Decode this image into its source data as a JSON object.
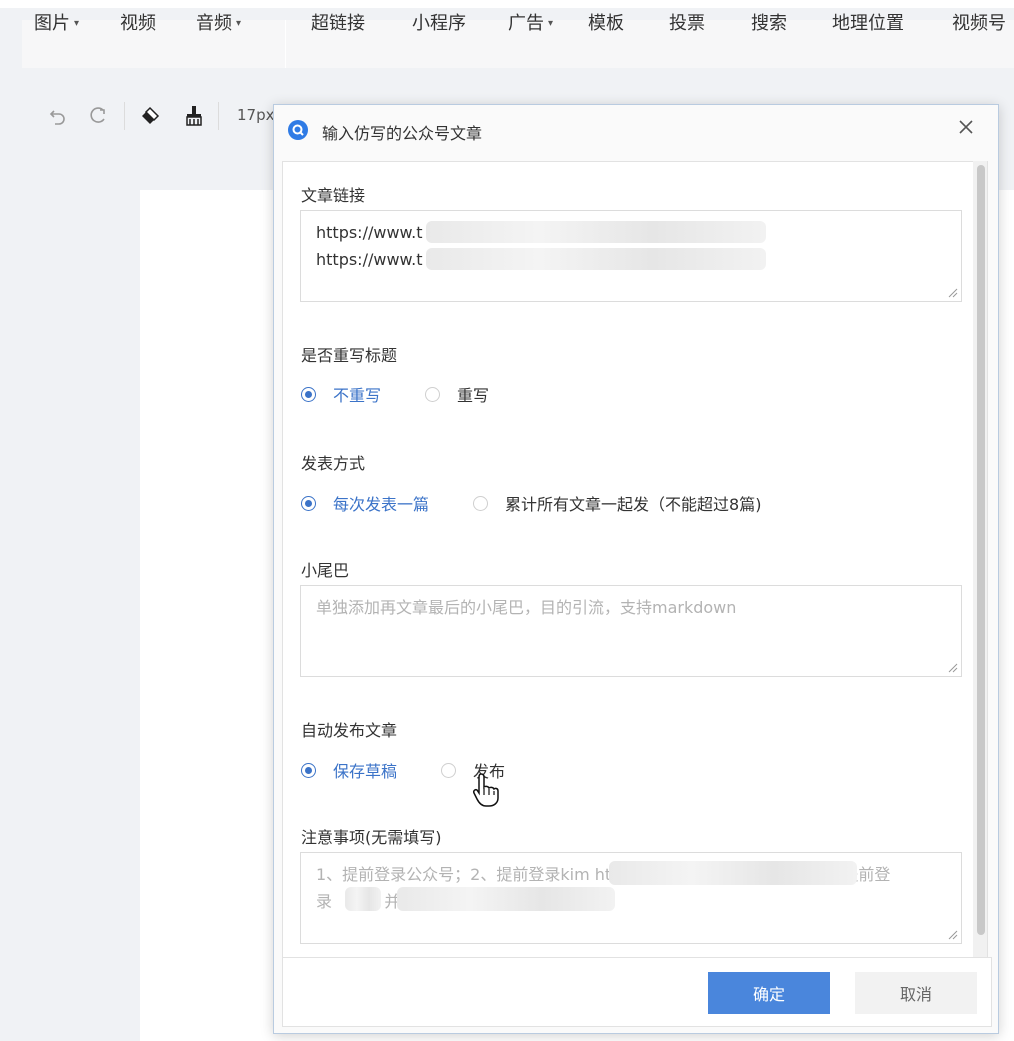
{
  "menubar": {
    "items": [
      {
        "label": "图片",
        "caret": true
      },
      {
        "label": "视频",
        "caret": false
      },
      {
        "label": "音频",
        "caret": true
      },
      {
        "label": "超链接",
        "caret": false
      },
      {
        "label": "小程序",
        "caret": false
      },
      {
        "label": "广告",
        "caret": true
      },
      {
        "label": "模板",
        "caret": false
      },
      {
        "label": "投票",
        "caret": false
      },
      {
        "label": "搜索",
        "caret": false
      },
      {
        "label": "地理位置",
        "caret": false
      },
      {
        "label": "视频号",
        "caret": false
      }
    ],
    "caret_glyph": "▾"
  },
  "toolbar": {
    "font_size": "17px",
    "icons": [
      "undo-icon",
      "redo-icon",
      "eraser-icon",
      "format-painter-icon"
    ]
  },
  "dialog": {
    "title": "输入仿写的公众号文章",
    "fields": {
      "article_link": {
        "label": "文章链接",
        "lines": [
          "https://www.t                                      41833375556/",
          "https://www.t                                      /"
        ]
      },
      "rewrite_title": {
        "label": "是否重写标题",
        "options": [
          "不重写",
          "重写"
        ],
        "selected": "不重写"
      },
      "publish_mode": {
        "label": "发表方式",
        "options": [
          "每次发表一篇",
          "累计所有文章一起发（不能超过8篇)"
        ],
        "selected": "每次发表一篇"
      },
      "tail": {
        "label": "小尾巴",
        "placeholder": "单独添加再文章最后的小尾巴，目的引流，支持markdown"
      },
      "auto_publish": {
        "label": "自动发布文章",
        "options": [
          "保存草稿",
          "发布"
        ],
        "selected": "保存草稿"
      },
      "notes": {
        "label": "注意事项(无需填写)",
        "lines": [
          "1、提前登录公众号；2、提前登录kim         https://kimi.moonshot.cn/；3、提前登",
          "录        （h                                  ，并创建一篇空的文章"
        ]
      }
    },
    "buttons": {
      "ok": "确定",
      "cancel": "取消"
    }
  },
  "colors": {
    "accent": "#3b73c8",
    "primary_button": "#4a86dc",
    "placeholder_text": "#b3b3b3"
  }
}
